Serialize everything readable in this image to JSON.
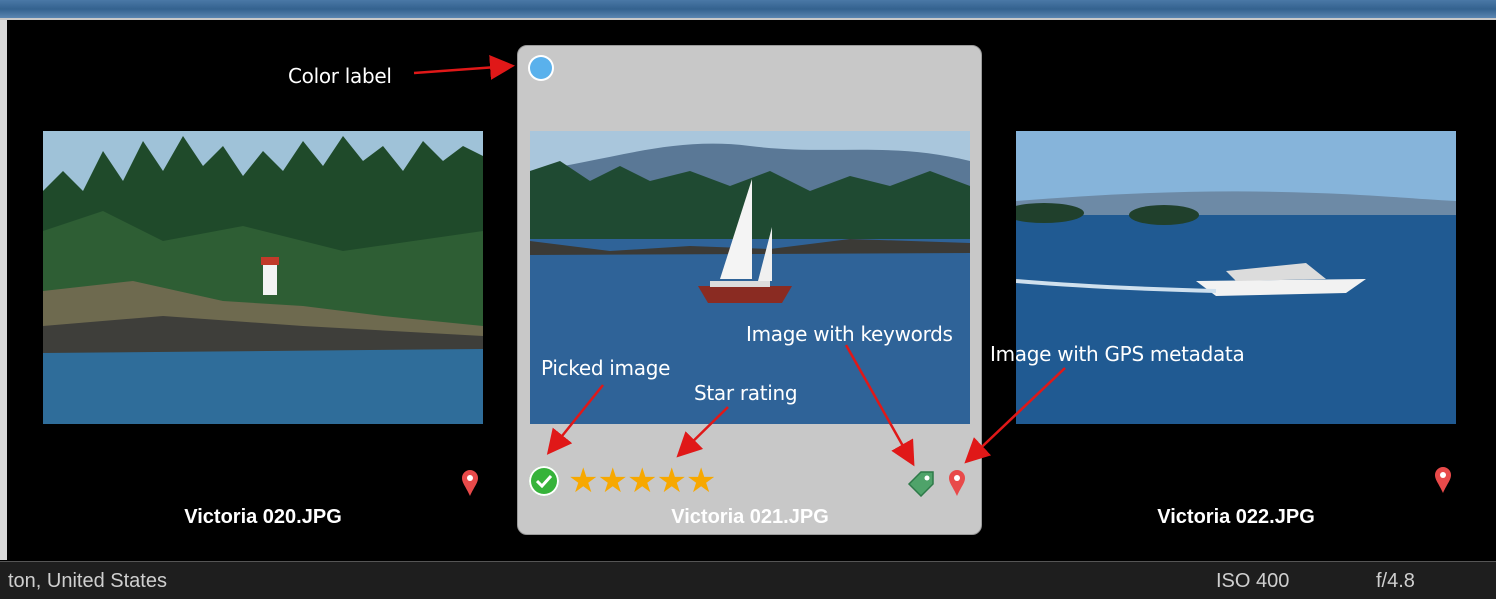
{
  "thumbnails": [
    {
      "filename": "Victoria 020.JPG",
      "has_gps": true
    },
    {
      "filename": "Victoria 021.JPG",
      "has_gps": true,
      "has_keywords": true,
      "picked": true,
      "stars": "★★★★★",
      "star_rating": 5,
      "color_label": "#5ab1ec",
      "selected": true
    },
    {
      "filename": "Victoria 022.JPG",
      "has_gps": true
    }
  ],
  "annotations": {
    "color_label": "Color label",
    "picked_image": "Picked image",
    "star_rating": "Star rating",
    "keywords": "Image with keywords",
    "gps": "Image with GPS metadata"
  },
  "status": {
    "location": "ton, United States",
    "iso": "ISO 400",
    "aperture": "f/4.8"
  },
  "colors": {
    "annotation_arrow": "#e01818",
    "pin": "#e84a4a",
    "pick": "#36b33a",
    "star": "#f7a800",
    "tag": "#4fa36a"
  }
}
